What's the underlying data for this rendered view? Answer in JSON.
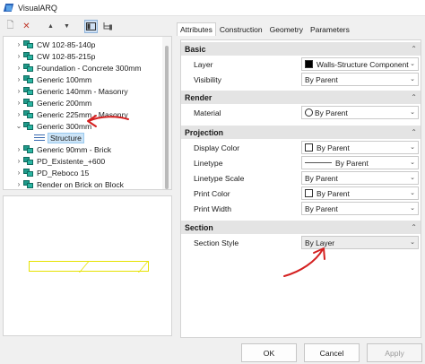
{
  "window": {
    "title": "VisualARQ"
  },
  "toolbar": {
    "items": [
      {
        "name": "new-style-icon",
        "glyph": "🗋"
      },
      {
        "name": "delete-icon",
        "glyph": "✕"
      },
      {
        "name": "move-up-icon",
        "glyph": "▲"
      },
      {
        "name": "move-down-icon",
        "glyph": "▼"
      },
      {
        "name": "view-mode-icon",
        "glyph": "▦"
      },
      {
        "name": "hierarchy-icon",
        "glyph": "⊞"
      }
    ]
  },
  "tree": {
    "items": [
      {
        "label": "CW 102-85-140p",
        "expanded": false
      },
      {
        "label": "CW 102-85-215p",
        "expanded": false
      },
      {
        "label": "Foundation - Concrete 300mm",
        "expanded": false
      },
      {
        "label": "Generic 100mm",
        "expanded": false
      },
      {
        "label": "Generic 140mm - Masonry",
        "expanded": false
      },
      {
        "label": "Generic 200mm",
        "expanded": false
      },
      {
        "label": "Generic 225mm - Masonry",
        "expanded": false
      },
      {
        "label": "Generic 300mm",
        "expanded": true
      },
      {
        "label": "Structure",
        "child": true,
        "selected": true
      },
      {
        "label": "Generic 90mm - Brick",
        "expanded": false
      },
      {
        "label": "PD_Existente_+600",
        "expanded": false
      },
      {
        "label": "PD_Reboco 15",
        "expanded": false
      },
      {
        "label": "Render on Brick on Block",
        "expanded": false
      }
    ]
  },
  "tabs": [
    "Attributes",
    "Construction",
    "Geometry",
    "Parameters"
  ],
  "sections": {
    "basic": {
      "title": "Basic"
    },
    "render": {
      "title": "Render"
    },
    "projection": {
      "title": "Projection"
    },
    "section": {
      "title": "Section"
    }
  },
  "props": {
    "layer": {
      "label": "Layer",
      "value": "Walls-Structure Component"
    },
    "visibility": {
      "label": "Visibility",
      "value": "By Parent"
    },
    "material": {
      "label": "Material",
      "value": "By Parent"
    },
    "display_color": {
      "label": "Display Color",
      "value": "By Parent"
    },
    "linetype": {
      "label": "Linetype",
      "value": "By Parent"
    },
    "linetype_scale": {
      "label": "Linetype Scale",
      "value": "By Parent"
    },
    "print_color": {
      "label": "Print Color",
      "value": "By Parent"
    },
    "print_width": {
      "label": "Print Width",
      "value": "By Parent"
    },
    "section_style": {
      "label": "Section Style",
      "value": "By Layer"
    }
  },
  "buttons": {
    "ok": "OK",
    "cancel": "Cancel",
    "apply": "Apply"
  },
  "colors": {
    "annotation": "#d42020",
    "wall_preview": "#e6e200",
    "selection": "#cce4f7"
  }
}
